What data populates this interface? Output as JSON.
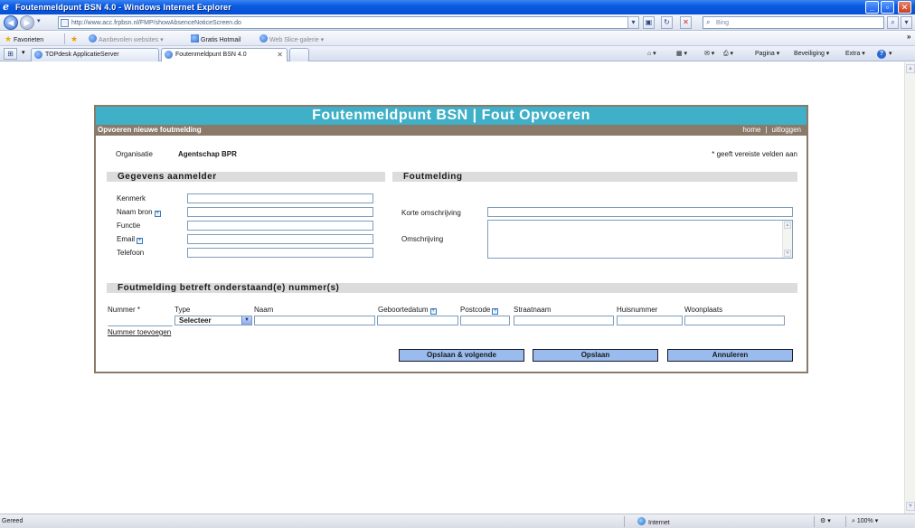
{
  "window": {
    "title": "Foutenmeldpunt BSN 4.0 - Windows Internet Explorer",
    "minimize": "_",
    "maximize": "▫",
    "close": "✕"
  },
  "addressbar": {
    "url": "http://www.acc.frpbsn.nl/FMP/showAbsenceNoticeScreen.do",
    "search_placeholder": "Bing"
  },
  "favorites": {
    "label": "Favorieten",
    "items": [
      "Aanbevolen websites ▾",
      "Gratis Hotmail",
      "Web Slice-galerie ▾"
    ]
  },
  "tabs": [
    {
      "label": "TOPdesk ApplicatieServer",
      "active": false
    },
    {
      "label": "Foutenmeldpunt BSN 4.0",
      "active": true
    }
  ],
  "commandbar": {
    "page": "Pagina ▾",
    "safety": "Beveiliging ▾",
    "extra": "Extra ▾",
    "help": "?"
  },
  "app": {
    "title": "Foutenmeldpunt BSN | Fout Opvoeren",
    "subtitle": "Opvoeren nieuwe foutmelding",
    "links": {
      "home": "home",
      "separator": "|",
      "logout": "uitloggen"
    },
    "org_label": "Organisatie",
    "org_value": "Agentschap BPR",
    "required_note": "* geeft vereiste velden aan",
    "section_reporter": "Gegevens aanmelder",
    "section_error": "Foutmelding",
    "section_numbers": "Foutmelding betreft onderstaand(e) nummer(s)",
    "reporter_fields": [
      {
        "label": "Kenmerk",
        "info": false,
        "value": ""
      },
      {
        "label": "Naam bron",
        "info": true,
        "value": ""
      },
      {
        "label": "Functie",
        "info": false,
        "value": ""
      },
      {
        "label": "Email",
        "info": true,
        "value": ""
      },
      {
        "label": "Telefoon",
        "info": false,
        "value": ""
      }
    ],
    "error_fields": {
      "short_label": "Korte omschrijving",
      "short_value": "",
      "long_label": "Omschrijving",
      "long_value": ""
    },
    "number_columns": [
      "Nummer *",
      "Type",
      "Naam",
      "Geboortedatum",
      "Postcode",
      "Straatnaam",
      "Huisnummer",
      "Woonplaats"
    ],
    "type_select_value": "Selecteer",
    "add_number_link": "Nummer toevoegen",
    "buttons": {
      "save_next": "Opslaan & volgende",
      "save": "Opslaan",
      "cancel": "Annuleren"
    },
    "info_glyph": "+"
  },
  "statusbar": {
    "text": "Gereed",
    "zone": "Internet",
    "zoom": "100%"
  },
  "colors": {
    "header": "#3fb0c8",
    "subheader": "#8a7a6a",
    "section": "#dcdcdc",
    "button": "#99bbee"
  }
}
